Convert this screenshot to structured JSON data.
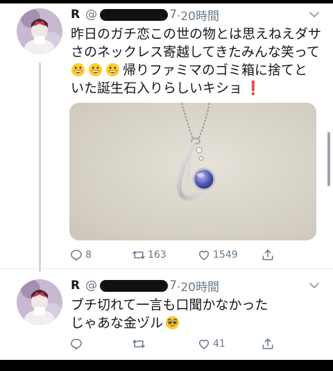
{
  "tweets": [
    {
      "name": "R",
      "handle_prefix": "@",
      "handle_suffix": "7",
      "time": "·20時間",
      "text_lines": [
        "昨日のガチ恋この世の物とは思えねえダサ",
        "さのネックレス寄越してきたみんな笑って",
        "帰りファミマのゴミ箱に捨てと",
        "いた誕生石入りらしいキショ"
      ],
      "line3_emoji": "grinning-face-emoji",
      "line4_emoji": "❗",
      "media_alt": "necklace-photo",
      "replies": "8",
      "retweets": "163",
      "likes": "1549"
    },
    {
      "name": "R",
      "handle_prefix": "@",
      "handle_suffix": "7",
      "time": "·20時間",
      "text_lines": [
        "ブチ切れて一言も口聞かなかった",
        "じゃあな金ヅル"
      ],
      "line2_emoji": "pleading-face-emoji",
      "replies": "",
      "retweets": "",
      "likes": "41"
    }
  ],
  "colors": {
    "text": "#14171a",
    "secondary": "#657786",
    "thread_line": "#ccd6dd",
    "alert": "#e0245e"
  }
}
